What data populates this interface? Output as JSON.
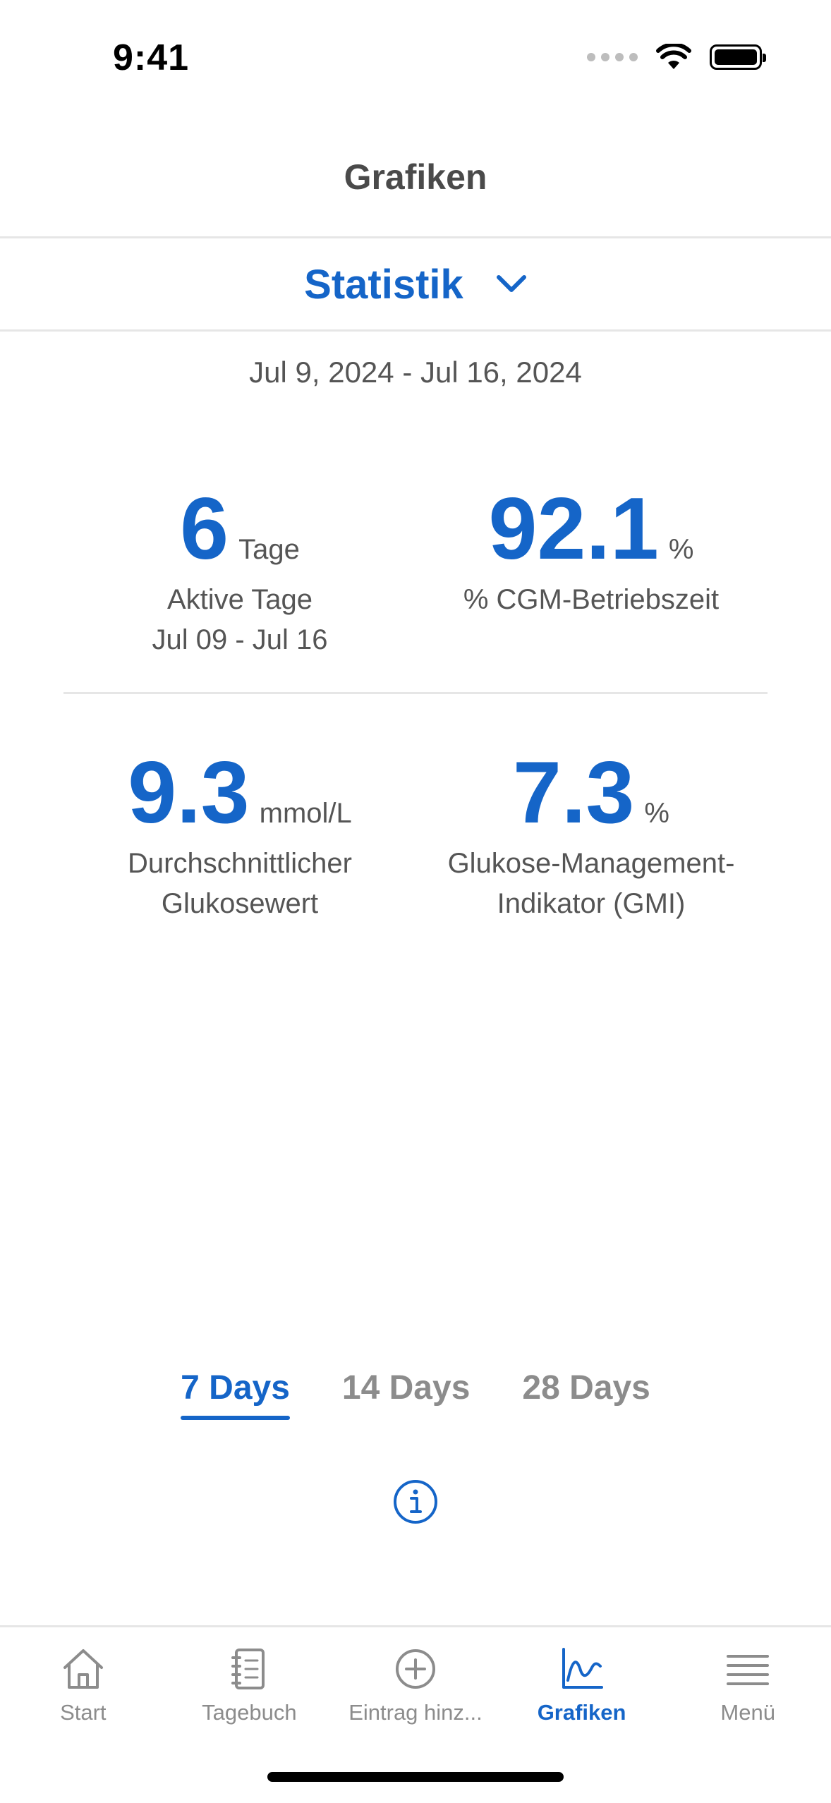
{
  "status_bar": {
    "time": "9:41"
  },
  "header": {
    "title": "Grafiken"
  },
  "section_selector": {
    "label": "Statistik"
  },
  "date_range": "Jul 9, 2024 - Jul 16, 2024",
  "stats": {
    "active_days": {
      "value": "6",
      "unit": "Tage",
      "label": "Aktive Tage",
      "sublabel": "Jul 09 - Jul 16"
    },
    "cgm_uptime": {
      "value": "92.1",
      "unit": "%",
      "label": "% CGM-Betriebszeit"
    },
    "avg_glucose": {
      "value": "9.3",
      "unit": "mmol/L",
      "label_line1": "Durchschnittlicher",
      "label_line2": "Glukosewert"
    },
    "gmi": {
      "value": "7.3",
      "unit": "%",
      "label_line1": "Glukose-Management-",
      "label_line2": "Indikator (GMI)"
    }
  },
  "range_tabs": [
    {
      "label": "7 Days",
      "active": true
    },
    {
      "label": "14 Days",
      "active": false
    },
    {
      "label": "28 Days",
      "active": false
    }
  ],
  "tab_bar": [
    {
      "label": "Start",
      "icon": "home-icon",
      "active": false
    },
    {
      "label": "Tagebuch",
      "icon": "notebook-icon",
      "active": false
    },
    {
      "label": "Eintrag hinz...",
      "icon": "add-circle-icon",
      "active": false
    },
    {
      "label": "Grafiken",
      "icon": "chart-line-icon",
      "active": true
    },
    {
      "label": "Menü",
      "icon": "menu-icon",
      "active": false
    }
  ],
  "colors": {
    "accent": "#1565c8",
    "inactive": "#8c8c8c",
    "text": "#555555"
  }
}
